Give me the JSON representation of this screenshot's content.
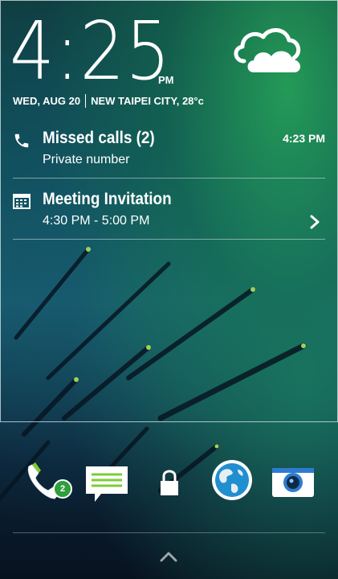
{
  "clock": {
    "time": "4:25",
    "ampm": "PM"
  },
  "date": {
    "day": "WED, AUG",
    "day_num": "20",
    "city": "NEW TAIPEI CITY,",
    "temp": "28°c"
  },
  "weather": {
    "icon": "cloudy-icon"
  },
  "notifications": [
    {
      "icon": "phone-icon",
      "title": "Missed calls (2)",
      "subtitle": "Private number",
      "time": "4:23 PM"
    },
    {
      "icon": "calendar-icon",
      "title": "Meeting Invitation",
      "subtitle": "4:30 PM - 5:00 PM",
      "action_icon": "chevron-right-icon"
    }
  ],
  "dock": [
    {
      "name": "phone-shortcut",
      "icon": "phone-icon",
      "badge": "2"
    },
    {
      "name": "messages-shortcut",
      "icon": "message-icon"
    },
    {
      "name": "unlock",
      "icon": "lock-icon"
    },
    {
      "name": "browser-shortcut",
      "icon": "globe-icon"
    },
    {
      "name": "camera-shortcut",
      "icon": "camera-icon"
    }
  ],
  "colors": {
    "accent_green": "#7ccc3a",
    "badge_green": "#2f9e3e",
    "camera_blue": "#2e7bd0"
  }
}
